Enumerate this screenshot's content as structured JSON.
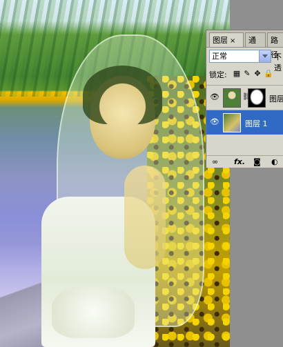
{
  "panel": {
    "tabs": [
      {
        "label": "图层"
      },
      {
        "label": "通道"
      },
      {
        "label": "路径"
      }
    ],
    "close_glyph": "×",
    "blend_mode": "正常",
    "opacity_label": "不透",
    "lock_label": "锁定:",
    "layers": [
      {
        "name": "图层"
      },
      {
        "name": "图层 1"
      }
    ],
    "bottom_icons": [
      "link-icon",
      "fx-icon",
      "mask-icon",
      "adjustment-icon"
    ],
    "bottom_text": {
      "fx": "fx."
    },
    "selection_color": "#316ac5"
  }
}
